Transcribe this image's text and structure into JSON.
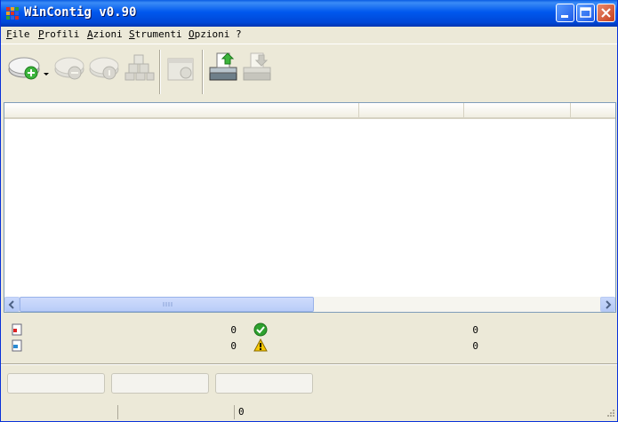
{
  "window": {
    "title": "WinContig v0.90"
  },
  "menu": {
    "items": [
      "File",
      "Profili",
      "Azioni",
      "Strumenti",
      "Opzioni",
      "?"
    ]
  },
  "toolbar": {
    "buttons": [
      {
        "icon": "add-drive-icon",
        "enabled": true,
        "has_dropdown": true
      },
      {
        "icon": "remove-drive-icon",
        "enabled": false
      },
      {
        "icon": "drive-info-icon",
        "enabled": false
      },
      {
        "icon": "cubes-icon",
        "enabled": false
      },
      {
        "icon": "analyze-icon",
        "enabled": false
      },
      {
        "icon": "drive-upload-icon",
        "enabled": true
      },
      {
        "icon": "drive-download-icon",
        "enabled": false
      }
    ]
  },
  "stats": {
    "files_count": "0",
    "ok_count": "0",
    "folders_count": "0",
    "warning_count": "0"
  },
  "statusbar": {
    "pane3": "0"
  },
  "colors": {
    "title_blue": "#0058ee",
    "ok_green": "#2ea12e",
    "warning_yellow": "#f6c800"
  }
}
